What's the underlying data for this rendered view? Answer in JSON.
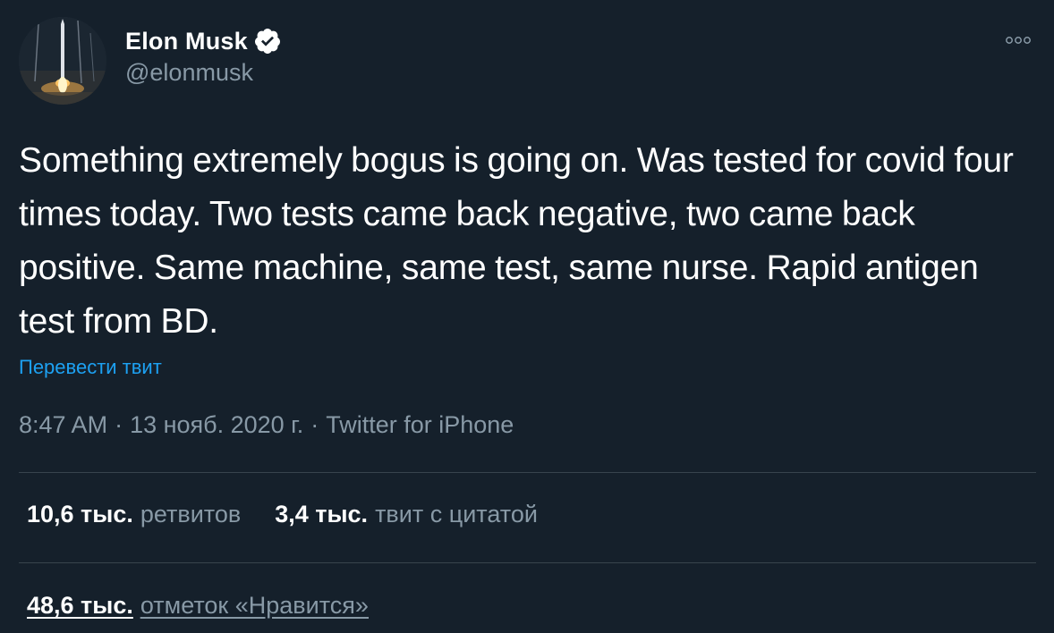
{
  "author": {
    "name": "Elon Musk",
    "handle": "@elonmusk",
    "verified": true
  },
  "tweet": {
    "text": "Something extremely bogus is going on. Was tested for covid four times today. Two tests came back negative, two came back positive. Same machine, same test, same nurse. Rapid antigen test from BD.",
    "translate_label": "Перевести твит",
    "time": "8:47 AM",
    "date": "13 нояб. 2020 г.",
    "separator": "·",
    "source": "Twitter for iPhone"
  },
  "stats": {
    "retweets": {
      "count": "10,6 тыс.",
      "label": "ретвитов"
    },
    "quote_tweets": {
      "count": "3,4 тыс.",
      "label": "твит с цитатой"
    },
    "likes": {
      "count": "48,6 тыс.",
      "label": "отметок «Нравится»"
    }
  },
  "icons": {
    "avatar": "rocket-launch-avatar",
    "verified": "verified-badge-icon",
    "more": "more-options-icon"
  },
  "colors": {
    "background": "#15202b",
    "text": "#ffffff",
    "secondary": "#8899a6",
    "link": "#1da1f2",
    "divider": "#38444d"
  }
}
